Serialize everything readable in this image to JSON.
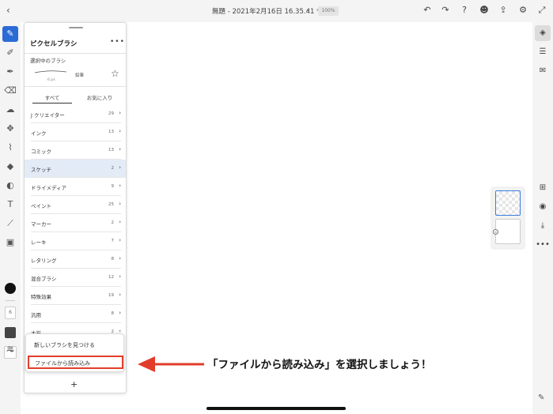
{
  "topbar": {
    "back_icon": "chevron-left-icon",
    "doc_title": "無題 - 2021年2月16日 16.35.41 *",
    "zoom": "100%",
    "icons": [
      "undo-icon",
      "redo-icon",
      "help-icon",
      "user-add-icon",
      "share-icon",
      "settings-icon",
      "fullscreen-icon"
    ]
  },
  "toolstrip": {
    "size_value": "6"
  },
  "panel": {
    "title": "ピクセルブラシ",
    "more": "•••",
    "selected_label": "選択中のブラシ",
    "brush_size": "6 px",
    "brush_name": "鉛筆",
    "tabs": [
      "すべて",
      "お気に入り"
    ],
    "items": [
      {
        "label": "J クリエイター",
        "count": "29"
      },
      {
        "label": "インク",
        "count": "13"
      },
      {
        "label": "コミック",
        "count": "13"
      },
      {
        "label": "スケッチ",
        "count": "2",
        "selected": true
      },
      {
        "label": "ドライメディア",
        "count": "9"
      },
      {
        "label": "ペイント",
        "count": "25"
      },
      {
        "label": "マーカー",
        "count": "2"
      },
      {
        "label": "レーキ",
        "count": "7"
      },
      {
        "label": "レタリング",
        "count": "8"
      },
      {
        "label": "混合ブラシ",
        "count": "12"
      },
      {
        "label": "特殊効果",
        "count": "19"
      },
      {
        "label": "汎用",
        "count": "8"
      },
      {
        "label": "木炭",
        "count": "2"
      }
    ]
  },
  "popover": {
    "find_new": "新しいブラシを見つける",
    "import_file": "ファイルから読み込み"
  },
  "add_symbol": "+",
  "annotation": {
    "text": "「ファイルから読み込み」を選択しましょう！",
    "arrow_color": "#e23d2b"
  },
  "colors": {
    "accent": "#2b6bd6",
    "highlight_border": "#e23d2b",
    "selected_row": "#e3ebf7"
  }
}
